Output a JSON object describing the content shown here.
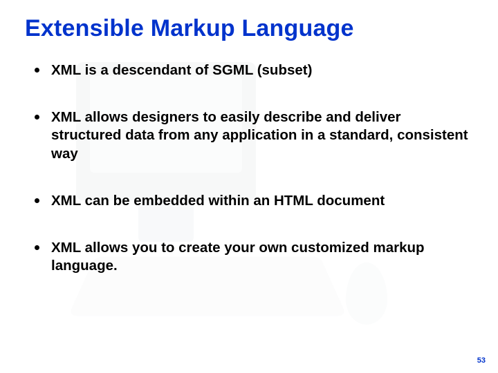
{
  "title": "Extensible Markup Language",
  "bullets": [
    "XML is a descendant of SGML (subset)",
    "XML allows designers to easily describe and deliver structured data from any application in a standard, consistent way",
    "XML can be embedded within an HTML document",
    "XML allows you to create your own customized markup language."
  ],
  "page_number": "53"
}
